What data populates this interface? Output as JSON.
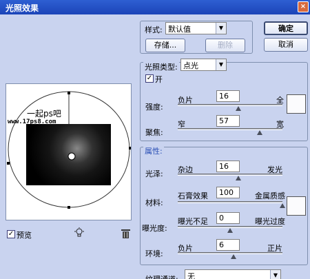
{
  "window": {
    "title": "光照效果",
    "close_glyph": "×"
  },
  "buttons": {
    "ok": "确定",
    "cancel": "取消",
    "save": "存储...",
    "delete": "删除"
  },
  "style": {
    "label": "样式:",
    "value": "默认值"
  },
  "light_type": {
    "label": "光照类型:",
    "value": "点光",
    "on_label": "开",
    "on_checked": true
  },
  "intensity": {
    "label": "强度:",
    "left": "负片",
    "right": "全",
    "value": "16",
    "level": 0.58
  },
  "focus": {
    "label": "聚焦:",
    "left": "窄",
    "right": "宽",
    "value": "57",
    "level": 0.78
  },
  "properties_header": "属性:",
  "gloss": {
    "label": "光泽:",
    "left": "杂边",
    "right": "发光",
    "value": "16",
    "level": 0.58
  },
  "material": {
    "label": "材料:",
    "left": "石膏效果",
    "right": "金属质感",
    "value": "100",
    "level": 1.0
  },
  "exposure": {
    "label": "曝光度:",
    "left": "曝光不足",
    "right": "曝光过度",
    "value": "0",
    "level": 0.5
  },
  "ambience": {
    "label": "环境:",
    "left": "负片",
    "right": "正片",
    "value": "6",
    "level": 0.53
  },
  "texture": {
    "label": "纹理通道:",
    "value": "无"
  },
  "preview": {
    "label": "预览",
    "checked": true,
    "watermark_cn": "一起ps吧",
    "watermark_url": "www.17ps8.com"
  },
  "icons": {
    "bulb": "light-bulb-icon",
    "trash": "trash-icon"
  },
  "colors": {
    "titlebar": "#1b44b8",
    "panel": "#c9d3ef",
    "properties_header": "#2a4fb5"
  }
}
